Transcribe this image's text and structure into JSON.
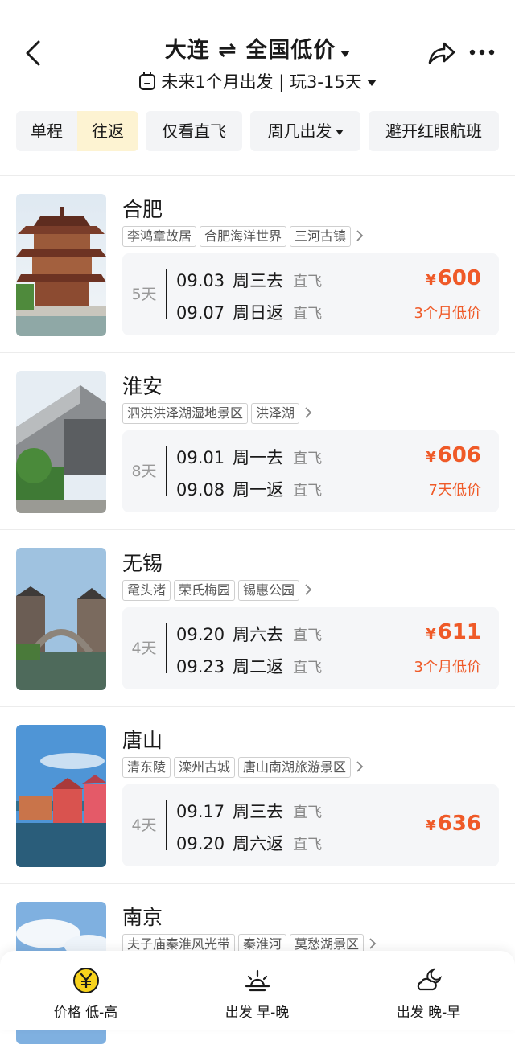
{
  "header": {
    "title": "大连 ⇌ 全国低价",
    "subtitle": "未来1个月出发 | 玩3-15天"
  },
  "filters": {
    "one_way": "单程",
    "round_trip": "往返",
    "direct_only": "仅看直飞",
    "weekday": "周几出发",
    "avoid_redeye": "避开红眼航班"
  },
  "cards": [
    {
      "city": "合肥",
      "tags": [
        "李鸿章故居",
        "合肥海洋世界",
        "三河古镇"
      ],
      "days": "5天",
      "out_date": "09.03",
      "out_day": "周三去",
      "out_type": "直飞",
      "ret_date": "09.07",
      "ret_day": "周日返",
      "ret_type": "直飞",
      "currency": "¥",
      "price": "600",
      "low": "3个月低价"
    },
    {
      "city": "淮安",
      "tags": [
        "泗洪洪泽湖湿地景区",
        "洪泽湖"
      ],
      "days": "8天",
      "out_date": "09.01",
      "out_day": "周一去",
      "out_type": "直飞",
      "ret_date": "09.08",
      "ret_day": "周一返",
      "ret_type": "直飞",
      "currency": "¥",
      "price": "606",
      "low": "7天低价"
    },
    {
      "city": "无锡",
      "tags": [
        "鼋头渚",
        "荣氏梅园",
        "锡惠公园"
      ],
      "days": "4天",
      "out_date": "09.20",
      "out_day": "周六去",
      "out_type": "直飞",
      "ret_date": "09.23",
      "ret_day": "周二返",
      "ret_type": "直飞",
      "currency": "¥",
      "price": "611",
      "low": "3个月低价"
    },
    {
      "city": "唐山",
      "tags": [
        "清东陵",
        "滦州古城",
        "唐山南湖旅游景区"
      ],
      "days": "4天",
      "out_date": "09.17",
      "out_day": "周三去",
      "out_type": "直飞",
      "ret_date": "09.20",
      "ret_day": "周六返",
      "ret_type": "直飞",
      "currency": "¥",
      "price": "636",
      "low": ""
    },
    {
      "city": "南京",
      "tags": [
        "夫子庙秦淮风光带",
        "秦淮河",
        "莫愁湖景区"
      ]
    }
  ],
  "sort_bar": {
    "price": "价格 低-高",
    "depart_early": "出发 早-晚",
    "depart_late": "出发 晚-早"
  },
  "colors": {
    "accent": "#ef5a28",
    "active_segment": "#fdf3d2",
    "chip_bg": "#f3f4f6",
    "price_icon": "#f7d21c"
  }
}
